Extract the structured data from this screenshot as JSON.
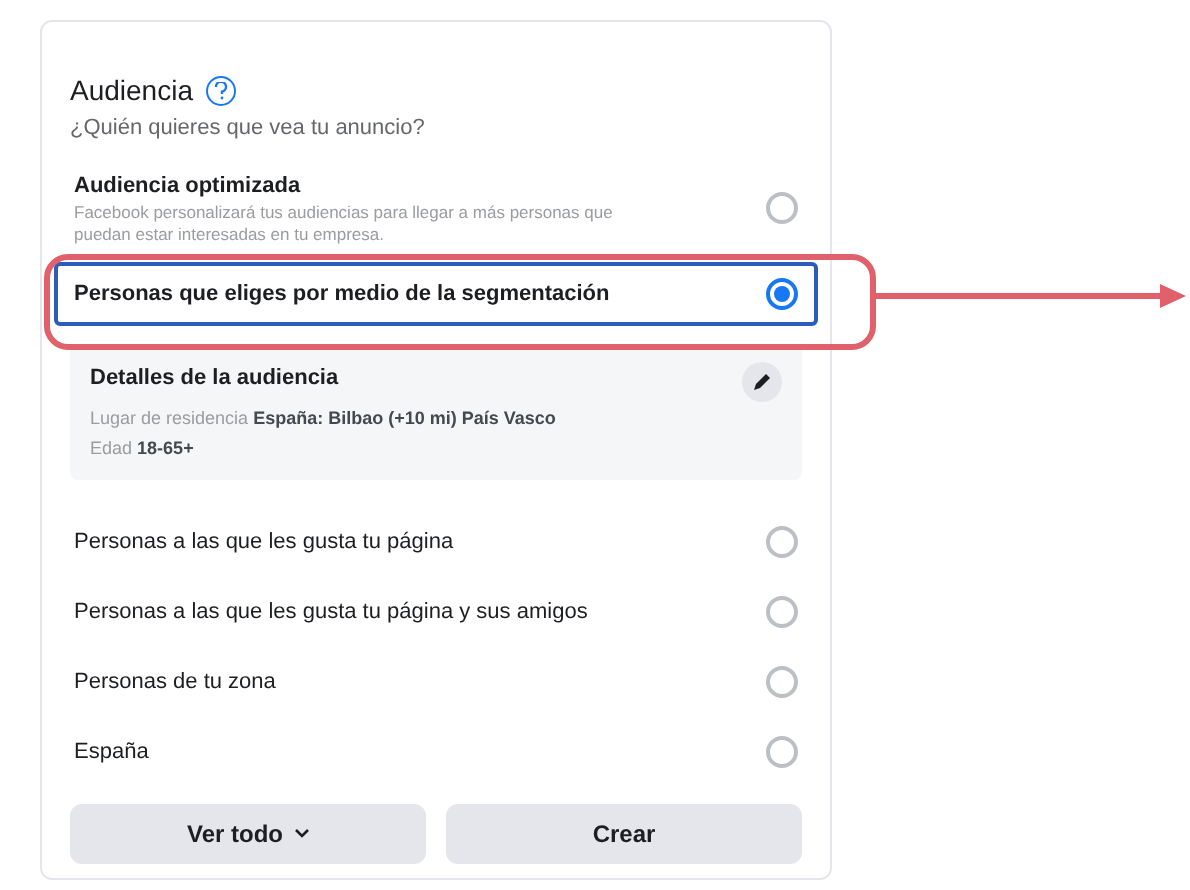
{
  "section": {
    "title": "Audiencia",
    "subtitle": "¿Quién quieres que vea tu anuncio?"
  },
  "options": [
    {
      "label": "Audiencia optimizada",
      "description": "Facebook personalizará tus audiencias para llegar a más personas que puedan estar interesadas en tu empresa.",
      "selected": false
    },
    {
      "label": "Personas que eliges por medio de la segmentación",
      "selected": true,
      "details": {
        "title": "Detalles de la audiencia",
        "lines": [
          {
            "label": "Lugar de residencia",
            "value": "España: Bilbao (+10 mi) País Vasco"
          },
          {
            "label": "Edad",
            "value": "18-65+"
          }
        ]
      }
    },
    {
      "label": "Personas a las que les gusta tu página",
      "selected": false
    },
    {
      "label": "Personas a las que les gusta tu página y sus amigos",
      "selected": false
    },
    {
      "label": "Personas de tu zona",
      "selected": false
    },
    {
      "label": "España",
      "selected": false
    }
  ],
  "buttons": [
    {
      "label": "Ver todo",
      "kind": "dropdown"
    },
    {
      "label": "Crear",
      "kind": "plain"
    }
  ]
}
